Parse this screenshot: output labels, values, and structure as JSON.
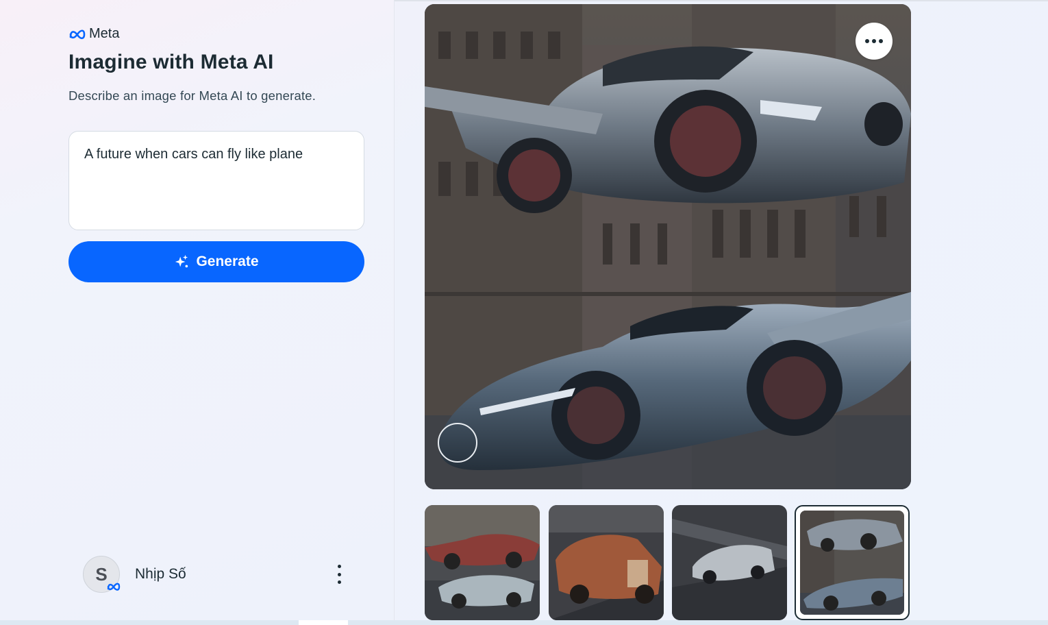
{
  "brand": {
    "name": "Meta",
    "logo_icon": "meta-infinity-logo",
    "color": "#0866ff"
  },
  "title": "Imagine with Meta AI",
  "subtitle": "Describe an image for Meta AI to generate.",
  "prompt": {
    "value": "A future when cars can fly like plane"
  },
  "generate_button": {
    "label": "Generate",
    "icon": "sparkle-icon"
  },
  "main_image": {
    "description_icon": "generated-image",
    "more_icon": "more-horizontal-icon"
  },
  "thumbnails": [
    {
      "selected": false
    },
    {
      "selected": false
    },
    {
      "selected": false
    },
    {
      "selected": true
    }
  ],
  "user": {
    "avatar_initial": "S",
    "name": "Nhịp Số",
    "menu_icon": "more-vertical-icon"
  }
}
